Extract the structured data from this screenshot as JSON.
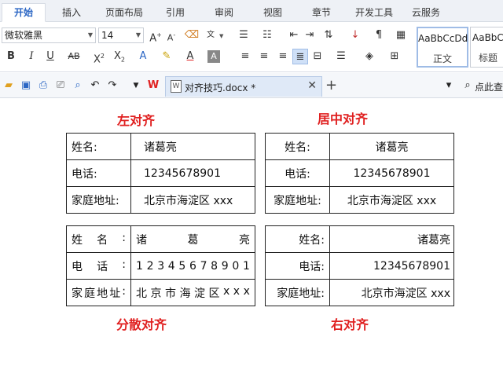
{
  "menu": {
    "tabs": [
      "开始",
      "插入",
      "页面布局",
      "引用",
      "审阅",
      "视图",
      "章节",
      "开发工具",
      "云服务"
    ],
    "active": "开始"
  },
  "ribbon": {
    "font_name": "微软雅黑",
    "font_size": "14",
    "styles": [
      {
        "sample": "AaBbCcDd",
        "name": "正文"
      },
      {
        "sample": "AaBbCc",
        "name": "标题"
      }
    ],
    "icons": [
      "grow-font",
      "shrink-font",
      "clear-format",
      "pinyin",
      "bullets",
      "numbering",
      "outdent",
      "indent",
      "text-direction",
      "sort",
      "show-marks",
      "table",
      "bold",
      "italic",
      "underline",
      "strikethrough",
      "superscript",
      "subscript",
      "text-effect",
      "highlight",
      "font-color",
      "char-shading",
      "align-left",
      "align-center",
      "align-right",
      "justify",
      "distribute",
      "line-spacing",
      "fill",
      "borders"
    ]
  },
  "quickbar": {
    "doc_title": "对齐技巧.docx *",
    "search_label": "点此查"
  },
  "document": {
    "headings": {
      "left": "左对齐",
      "center": "居中对齐",
      "distributed": "分散对齐",
      "right": "右对齐"
    },
    "rows": [
      {
        "key": "姓名:",
        "value": "诸葛亮"
      },
      {
        "key": "电话:",
        "value": "12345678901"
      },
      {
        "key": "家庭地址:",
        "value": "北京市海淀区 xxx"
      }
    ]
  }
}
